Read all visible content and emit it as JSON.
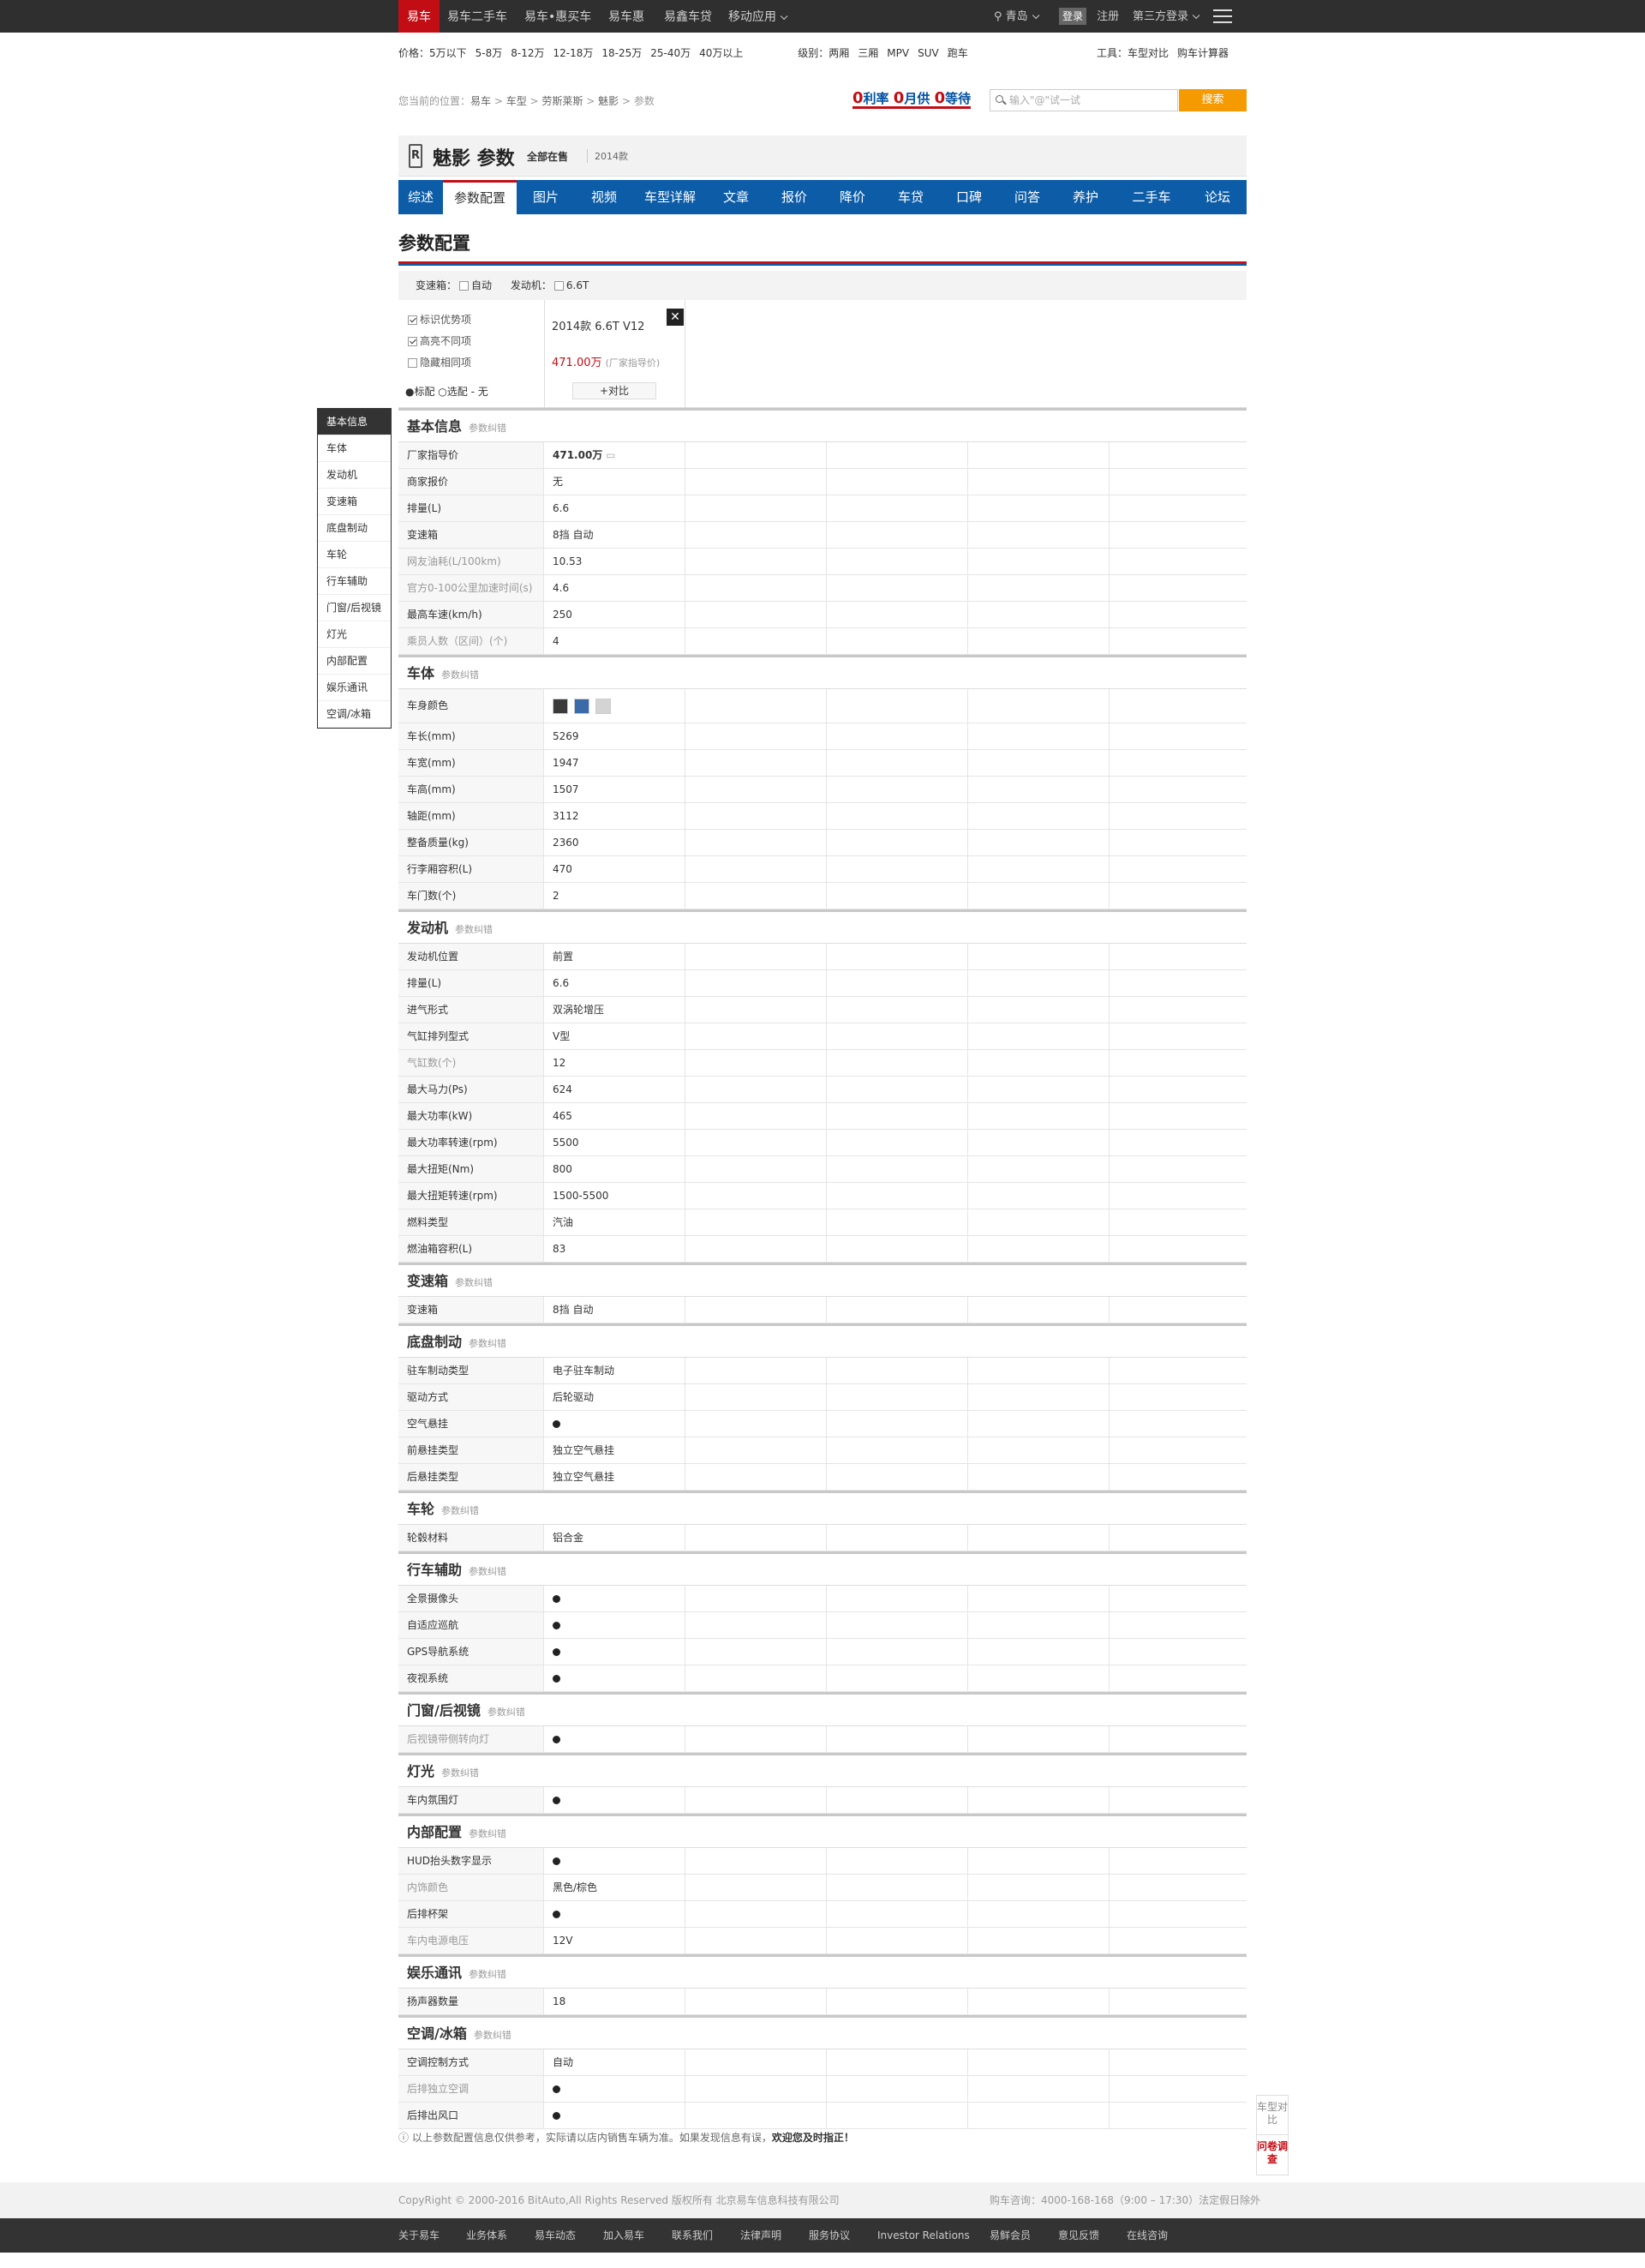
{
  "topbar": {
    "tabs": [
      "易车",
      "易车二手车",
      "易车•惠买车",
      "易车惠",
      "易鑫车贷",
      "移动应用"
    ],
    "city": "青岛",
    "login": "登录",
    "register": "注册",
    "third_login": "第三方登录"
  },
  "filter": {
    "price_label": "价格：",
    "prices": [
      "5万以下",
      "5-8万",
      "8-12万",
      "12-18万",
      "18-25万",
      "25-40万",
      "40万以上"
    ],
    "level_label": "级别：",
    "levels": [
      "两厢",
      "三厢",
      "MPV",
      "SUV",
      "跑车"
    ],
    "tools_label": "工具：",
    "tools": [
      "车型对比",
      "购车计算器"
    ]
  },
  "breadcrumb": {
    "prefix": "您当前的位置：",
    "items": [
      "易车",
      "车型",
      "劳斯莱斯",
      "魅影",
      "参数"
    ]
  },
  "search": {
    "promo": [
      "0",
      "利率",
      "0",
      "月供",
      "0",
      "等待"
    ],
    "placeholder": "输入\"@\"试一试",
    "button": "搜索"
  },
  "head": {
    "brand_logo": "R",
    "title": "魅影 参数",
    "status": "全部在售",
    "year": "2014款"
  },
  "nav": [
    "综述",
    "参数配置",
    "图片",
    "视频",
    "车型详解",
    "文章",
    "报价",
    "降价",
    "车贷",
    "口碑",
    "问答",
    "养护",
    "二手车",
    "论坛"
  ],
  "page_title": "参数配置",
  "optbar": {
    "gearbox": "变速箱：",
    "auto": "自动",
    "engine": "发动机：",
    "engine_opt": "6.6T"
  },
  "carhead": {
    "options": [
      "标识优势项",
      "高亮不同项",
      "隐藏相同项"
    ],
    "legend": "●标配 ○选配 - 无",
    "name": "2014款 6.6T V12",
    "price": "471.00万",
    "price_note": "(厂家指导价)",
    "close": "✕",
    "compare": "+对比"
  },
  "sidebar": [
    "基本信息",
    "车体",
    "发动机",
    "变速箱",
    "底盘制动",
    "车轮",
    "行车辅助",
    "门窗/后视镜",
    "灯光",
    "内部配置",
    "娱乐通讯",
    "空调/冰箱"
  ],
  "colors": {
    "swatch1": "#3a3a3a",
    "swatch2": "#3a6aa8",
    "swatch3": "#d4d4d4",
    "accent": "#c30d15",
    "nav": "#0c5ca8"
  },
  "sections": [
    {
      "title": "基本信息",
      "sub": "参数纠错",
      "rows": [
        {
          "k": "厂家指导价",
          "v": "471.00万",
          "bold": true
        },
        {
          "k": "商家报价",
          "v": "无"
        },
        {
          "k": "排量(L)",
          "v": "6.6"
        },
        {
          "k": "变速箱",
          "v": "8挡 自动"
        },
        {
          "k": "网友油耗(L/100km)",
          "v": "10.53",
          "gray": true
        },
        {
          "k": "官方0-100公里加速时间(s)",
          "v": "4.6",
          "gray": true
        },
        {
          "k": "最高车速(km/h)",
          "v": "250"
        },
        {
          "k": "乘员人数（区间）(个)",
          "v": "4",
          "gray": true
        }
      ]
    },
    {
      "title": "车体",
      "sub": "参数纠错",
      "rows": [
        {
          "k": "车身颜色",
          "v": "",
          "swatch": true
        },
        {
          "k": "车长(mm)",
          "v": "5269"
        },
        {
          "k": "车宽(mm)",
          "v": "1947"
        },
        {
          "k": "车高(mm)",
          "v": "1507"
        },
        {
          "k": "轴距(mm)",
          "v": "3112"
        },
        {
          "k": "整备质量(kg)",
          "v": "2360"
        },
        {
          "k": "行李厢容积(L)",
          "v": "470"
        },
        {
          "k": "车门数(个)",
          "v": "2"
        }
      ]
    },
    {
      "title": "发动机",
      "sub": "参数纠错",
      "rows": [
        {
          "k": "发动机位置",
          "v": "前置"
        },
        {
          "k": "排量(L)",
          "v": "6.6"
        },
        {
          "k": "进气形式",
          "v": "双涡轮增压"
        },
        {
          "k": "气缸排列型式",
          "v": "V型"
        },
        {
          "k": "气缸数(个)",
          "v": "12",
          "gray": true
        },
        {
          "k": "最大马力(Ps)",
          "v": "624"
        },
        {
          "k": "最大功率(kW)",
          "v": "465"
        },
        {
          "k": "最大功率转速(rpm)",
          "v": "5500"
        },
        {
          "k": "最大扭矩(Nm)",
          "v": "800"
        },
        {
          "k": "最大扭矩转速(rpm)",
          "v": "1500-5500"
        },
        {
          "k": "燃料类型",
          "v": "汽油"
        },
        {
          "k": "燃油箱容积(L)",
          "v": "83"
        }
      ]
    },
    {
      "title": "变速箱",
      "sub": "参数纠错",
      "rows": [
        {
          "k": "变速箱",
          "v": "8挡 自动"
        }
      ]
    },
    {
      "title": "底盘制动",
      "sub": "参数纠错",
      "rows": [
        {
          "k": "驻车制动类型",
          "v": "电子驻车制动"
        },
        {
          "k": "驱动方式",
          "v": "后轮驱动"
        },
        {
          "k": "空气悬挂",
          "v": "",
          "dot": true
        },
        {
          "k": "前悬挂类型",
          "v": "独立空气悬挂"
        },
        {
          "k": "后悬挂类型",
          "v": "独立空气悬挂"
        }
      ]
    },
    {
      "title": "车轮",
      "sub": "参数纠错",
      "rows": [
        {
          "k": "轮毂材料",
          "v": "铝合金"
        }
      ]
    },
    {
      "title": "行车辅助",
      "sub": "参数纠错",
      "rows": [
        {
          "k": "全景摄像头",
          "v": "",
          "dot": true
        },
        {
          "k": "自适应巡航",
          "v": "",
          "dot": true
        },
        {
          "k": "GPS导航系统",
          "v": "",
          "dot": true
        },
        {
          "k": "夜视系统",
          "v": "",
          "dot": true
        }
      ]
    },
    {
      "title": "门窗/后视镜",
      "sub": "参数纠错",
      "rows": [
        {
          "k": "后视镜带侧转向灯",
          "v": "",
          "dot": true,
          "gray": true
        }
      ]
    },
    {
      "title": "灯光",
      "sub": "参数纠错",
      "rows": [
        {
          "k": "车内氛围灯",
          "v": "",
          "dot": true
        }
      ]
    },
    {
      "title": "内部配置",
      "sub": "参数纠错",
      "rows": [
        {
          "k": "HUD抬头数字显示",
          "v": "",
          "dot": true
        },
        {
          "k": "内饰颜色",
          "v": "黑色/棕色",
          "gray": true
        },
        {
          "k": "后排杯架",
          "v": "",
          "dot": true
        },
        {
          "k": "车内电源电压",
          "v": "12V",
          "gray": true
        }
      ]
    },
    {
      "title": "娱乐通讯",
      "sub": "参数纠错",
      "rows": [
        {
          "k": "扬声器数量",
          "v": "18"
        }
      ]
    },
    {
      "title": "空调/冰箱",
      "sub": "参数纠错",
      "rows": [
        {
          "k": "空调控制方式",
          "v": "自动"
        },
        {
          "k": "后排独立空调",
          "v": "",
          "dot": true,
          "gray": true
        },
        {
          "k": "后排出风口",
          "v": "",
          "dot": true
        }
      ]
    }
  ],
  "note": {
    "text": "以上参数配置信息仅供参考，实际请以店内销售车辆为准。如果发现信息有误，",
    "link": "欢迎您及时指正！"
  },
  "float": {
    "compare": "车型对比",
    "survey": "问卷调查"
  },
  "footer": {
    "copyright": "CopyRight © 2000-2016 BitAuto,All Rights Reserved  版权所有  北京易车信息科技有限公司",
    "hotline": "购车咨询：4000-168-168（9:00 – 17:30）法定假日除外",
    "links": [
      "关于易车",
      "业务体系",
      "易车动态",
      "加入易车",
      "联系我们",
      "法律声明",
      "服务协议",
      "Investor Relations",
      "易鲜会员",
      "意见反馈",
      "在线咨询"
    ]
  }
}
